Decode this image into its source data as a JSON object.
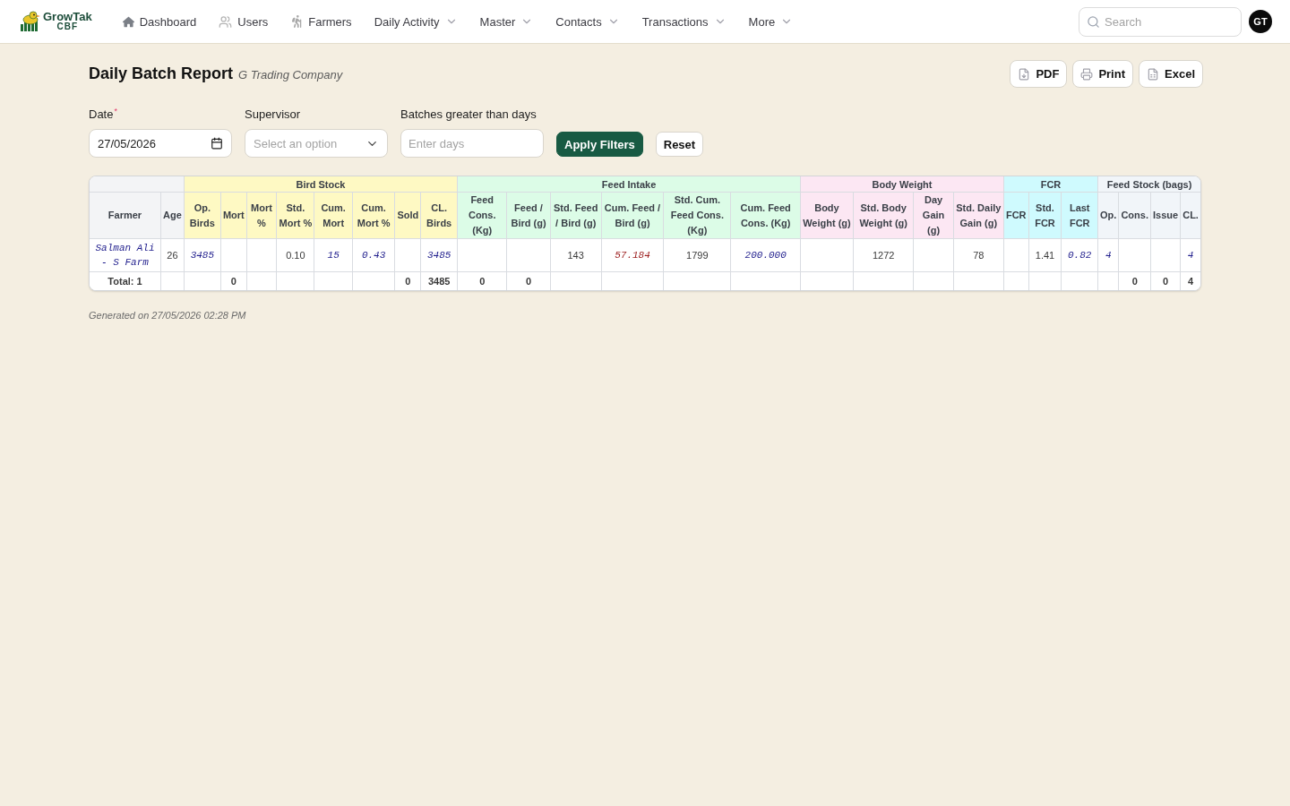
{
  "nav": {
    "brand": {
      "name": "GrowTak",
      "subtitle": "CBF"
    },
    "items": [
      {
        "label": "Dashboard",
        "dropdown": false
      },
      {
        "label": "Users",
        "dropdown": false
      },
      {
        "label": "Farmers",
        "dropdown": false
      },
      {
        "label": "Daily Activity",
        "dropdown": true
      },
      {
        "label": "Master",
        "dropdown": true
      },
      {
        "label": "Contacts",
        "dropdown": true
      },
      {
        "label": "Transactions",
        "dropdown": true
      },
      {
        "label": "More",
        "dropdown": true
      }
    ],
    "search": {
      "placeholder": "Search"
    },
    "avatar": "GT"
  },
  "page": {
    "title": "Daily Batch Report",
    "company": "G Trading Company"
  },
  "actions": [
    {
      "label": "PDF"
    },
    {
      "label": "Print"
    },
    {
      "label": "Excel"
    }
  ],
  "filters": [
    {
      "kind": "date",
      "label": "Date",
      "required_mark": "*",
      "value": "27/05/2026"
    },
    {
      "kind": "select",
      "label": "Supervisor",
      "placeholder": "Select an option"
    },
    {
      "kind": "number",
      "label": "Batches greater than days",
      "placeholder": "Enter days"
    }
  ],
  "filter_buttons": [
    {
      "label": "Apply Filters",
      "kind": "primary"
    },
    {
      "label": "Reset",
      "kind": "secondary"
    }
  ],
  "table": {
    "groups": [
      {
        "color": "#f3f4f6",
        "columns": [
          "Farmer",
          "Age"
        ]
      },
      {
        "title": "Bird Stock",
        "color": "#fef9c3",
        "columns": [
          "Op. Birds",
          "Mort",
          "Mort %",
          "Std. Mort %",
          "Cum. Mort",
          "Cum. Mort %",
          "Sold",
          "CL. Birds"
        ]
      },
      {
        "title": "Feed Intake",
        "color": "#dcfce7",
        "columns": [
          "Feed Cons. (Kg)",
          "Feed / Bird (g)",
          "Std. Feed / Bird (g)",
          "Cum. Feed / Bird (g)",
          "Std. Cum. Feed Cons. (Kg)",
          "Cum. Feed Cons. (Kg)"
        ]
      },
      {
        "title": "Body Weight",
        "color": "#fce7f3",
        "columns": [
          "Body Weight (g)",
          "Std. Body Weight (g)",
          "Day Gain (g)",
          "Std. Daily Gain (g)"
        ]
      },
      {
        "title": "FCR",
        "color": "#cffafe",
        "columns": [
          "FCR",
          "Std. FCR",
          "Last FCR"
        ]
      },
      {
        "title": "Feed Stock (bags)",
        "color": "#f1f5f9",
        "columns": [
          "Op.",
          "Cons.",
          "Issue",
          "CL."
        ]
      }
    ],
    "rows": [
      {
        "kind": "data",
        "cells": [
          {
            "text": "Salman Ali - S Farm",
            "kind": "value"
          },
          {
            "text": "26",
            "kind": "plain"
          },
          {
            "text": "3485",
            "kind": "value"
          },
          {
            "kind": "blank"
          },
          {
            "kind": "blank"
          },
          {
            "text": "0.10",
            "kind": "plain"
          },
          {
            "text": "15",
            "kind": "value"
          },
          {
            "text": "0.43",
            "kind": "value"
          },
          {
            "kind": "blank"
          },
          {
            "text": "3485",
            "kind": "value"
          },
          {
            "kind": "blank"
          },
          {
            "kind": "blank"
          },
          {
            "text": "143",
            "kind": "plain"
          },
          {
            "text": "57.184",
            "kind": "alert"
          },
          {
            "text": "1799",
            "kind": "plain"
          },
          {
            "text": "200.000",
            "kind": "value"
          },
          {
            "kind": "blank"
          },
          {
            "text": "1272",
            "kind": "plain"
          },
          {
            "kind": "blank"
          },
          {
            "text": "78",
            "kind": "plain"
          },
          {
            "kind": "blank"
          },
          {
            "text": "1.41",
            "kind": "plain"
          },
          {
            "text": "0.82",
            "kind": "value"
          },
          {
            "text": "4",
            "kind": "value"
          },
          {
            "kind": "blank"
          },
          {
            "kind": "blank"
          },
          {
            "text": "4",
            "kind": "value"
          }
        ]
      },
      {
        "kind": "total",
        "cells": [
          {
            "text": "Total: 1",
            "kind": "plain"
          },
          {
            "kind": "blank"
          },
          {
            "kind": "blank"
          },
          {
            "text": "0",
            "kind": "plain"
          },
          {
            "kind": "blank"
          },
          {
            "kind": "blank"
          },
          {
            "kind": "blank"
          },
          {
            "kind": "blank"
          },
          {
            "text": "0",
            "kind": "plain"
          },
          {
            "text": "3485",
            "kind": "plain"
          },
          {
            "text": "0",
            "kind": "plain"
          },
          {
            "text": "0",
            "kind": "plain"
          },
          {
            "kind": "blank"
          },
          {
            "kind": "blank"
          },
          {
            "kind": "blank"
          },
          {
            "kind": "blank"
          },
          {
            "kind": "blank"
          },
          {
            "kind": "blank"
          },
          {
            "kind": "blank"
          },
          {
            "kind": "blank"
          },
          {
            "kind": "blank"
          },
          {
            "kind": "blank"
          },
          {
            "kind": "blank"
          },
          {
            "kind": "blank"
          },
          {
            "text": "0",
            "kind": "plain"
          },
          {
            "text": "0",
            "kind": "plain"
          },
          {
            "text": "4",
            "kind": "plain"
          }
        ]
      }
    ]
  },
  "footer": "Generated on 27/05/2026 02:28 PM"
}
